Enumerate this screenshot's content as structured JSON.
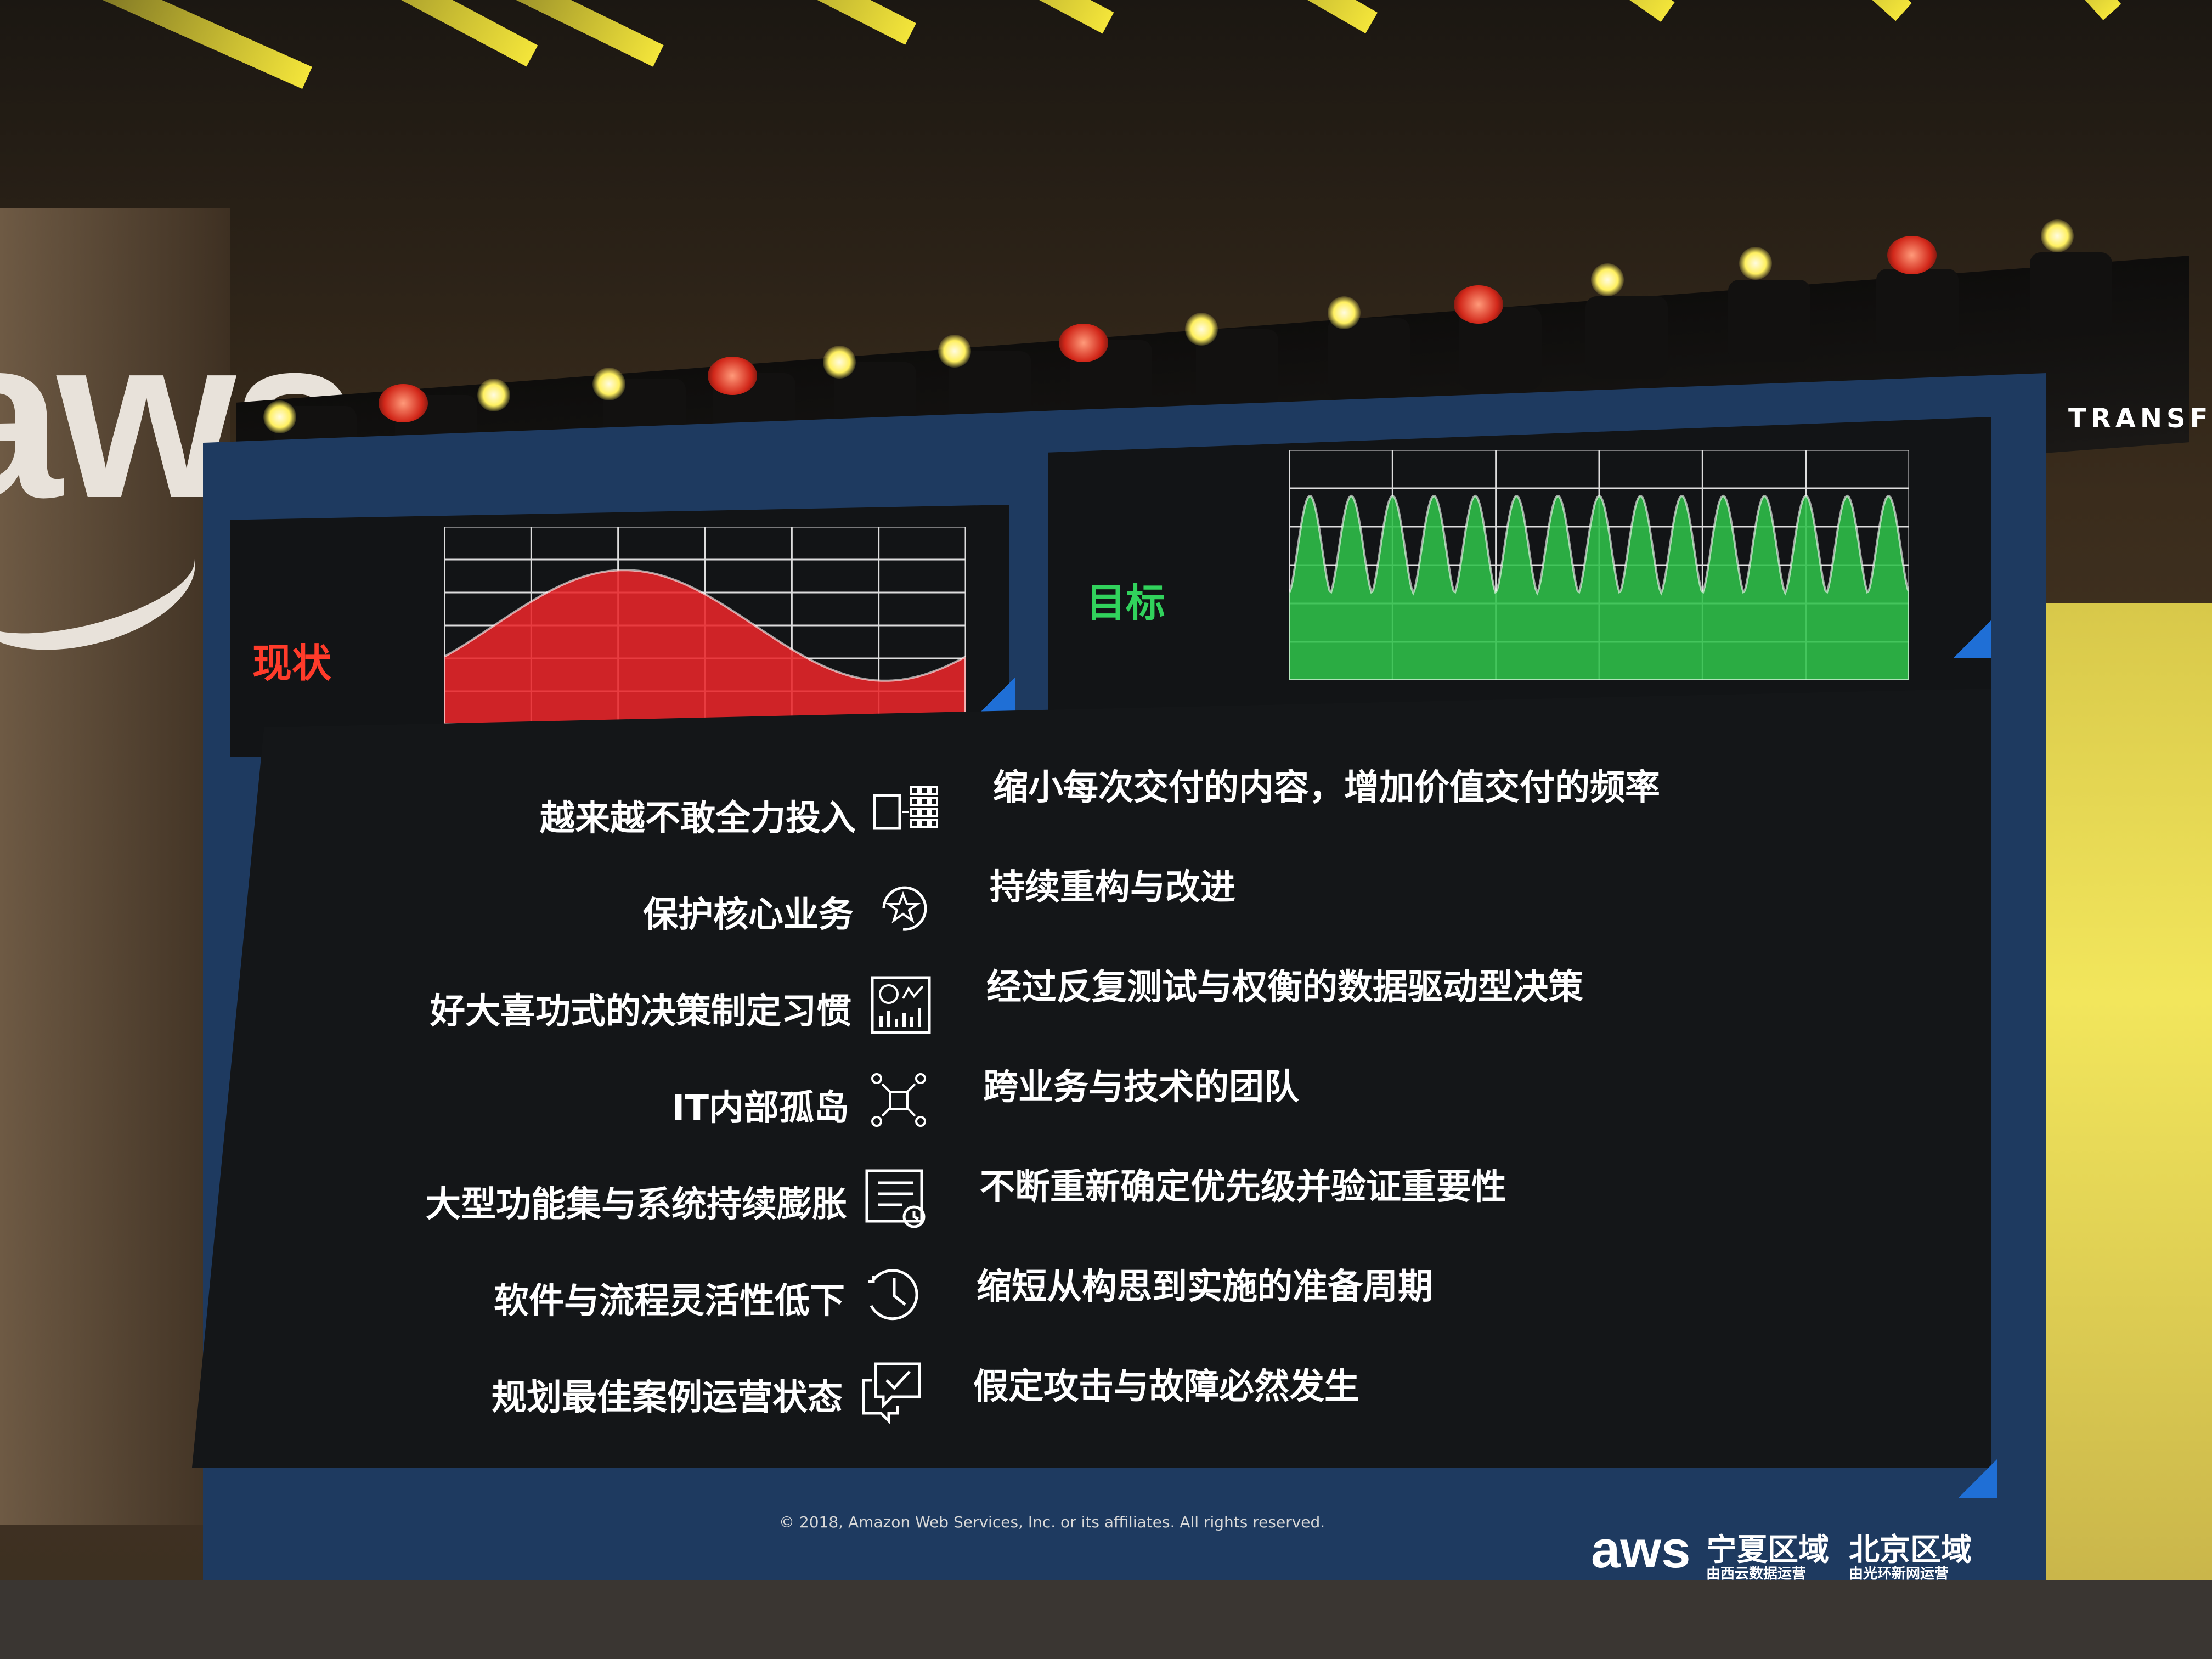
{
  "scene": {
    "backdrop_logo": "aws",
    "side_banner": "TRANSFO"
  },
  "slide": {
    "current_label": "现状",
    "target_label": "目标",
    "current_chart": {
      "type": "area",
      "color": "#e9252a",
      "shape": "slow-wave",
      "cycles": 1
    },
    "target_chart": {
      "type": "area",
      "color": "#2fc24a",
      "shape": "fast-wave",
      "cycles": 15
    },
    "rows": [
      {
        "from": "越来越不敢全力投入",
        "icon": "split-blocks-icon",
        "to": "缩小每次交付的内容，增加价值交付的频率"
      },
      {
        "from": "保护核心业务",
        "icon": "cycle-star-icon",
        "to": "持续重构与改进"
      },
      {
        "from": "好大喜功式的决策制定习惯",
        "icon": "dashboard-icon",
        "to": "经过反复测试与权衡的数据驱动型决策"
      },
      {
        "from": "IT内部孤岛",
        "icon": "team-network-icon",
        "to": "跨业务与技术的团队"
      },
      {
        "from": "大型功能集与系统持续膨胀",
        "icon": "checklist-clock-icon",
        "to": "不断重新确定优先级并验证重要性"
      },
      {
        "from": "软件与流程灵活性低下",
        "icon": "clock-icon",
        "to": "缩短从构思到实施的准备周期"
      },
      {
        "from": "规划最佳案例运营状态",
        "icon": "chat-check-icon",
        "to": "假定攻击与故障必然发生"
      }
    ],
    "footer": {
      "copyright": "© 2018, Amazon Web Services, Inc. or its affiliates. All rights reserved.",
      "logo": "aws",
      "region1_title": "宁夏区域",
      "region1_sub": "由西云数据运营",
      "region2_title": "北京区域",
      "region2_sub": "由光环新网运营"
    }
  }
}
